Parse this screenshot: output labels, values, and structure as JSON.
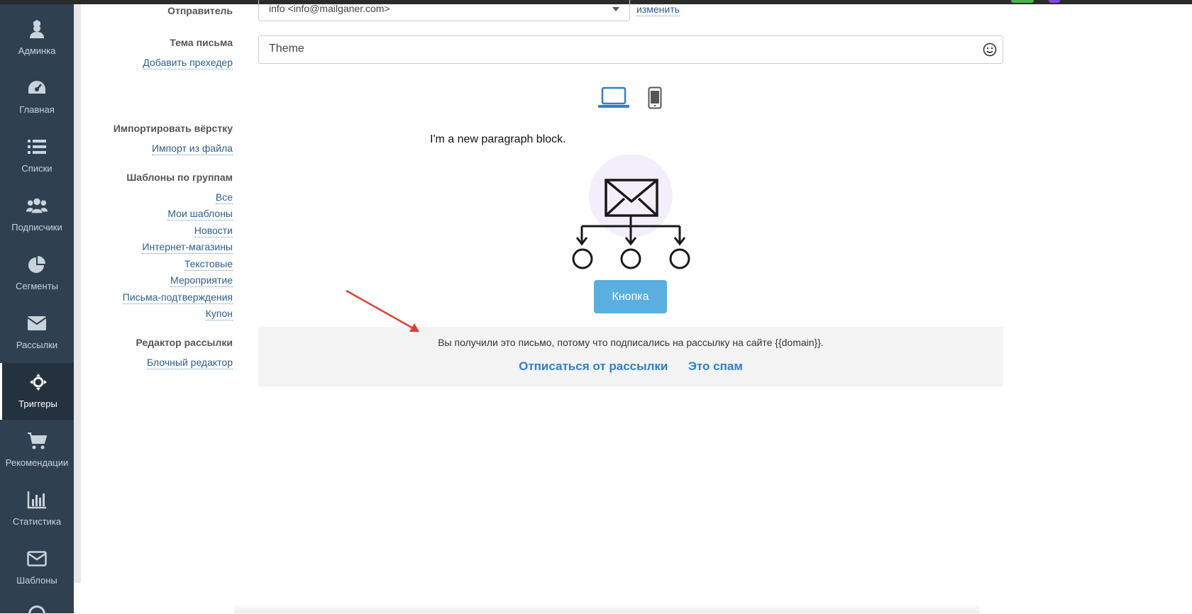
{
  "sidebar": {
    "items": [
      {
        "label": "Админка",
        "icon": "admin-user-icon"
      },
      {
        "label": "Главная",
        "icon": "dashboard-icon"
      },
      {
        "label": "Списки",
        "icon": "list-icon"
      },
      {
        "label": "Подписчики",
        "icon": "users-icon"
      },
      {
        "label": "Сегменты",
        "icon": "pie-chart-icon"
      },
      {
        "label": "Рассылки",
        "icon": "envelope-icon"
      },
      {
        "label": "Триггеры",
        "icon": "crosshair-icon",
        "active": true
      },
      {
        "label": "Рекомендации",
        "icon": "cart-icon"
      },
      {
        "label": "Статистика",
        "icon": "bar-chart-icon"
      },
      {
        "label": "Шаблоны",
        "icon": "envelope-outline-icon"
      }
    ]
  },
  "form": {
    "sender_label": "Отправитель",
    "sender_value": "info <info@mailganer.com>",
    "change_link": "изменить",
    "subject_label": "Тема письма",
    "add_preheader": "Добавить прехедер",
    "subject_value": "Theme"
  },
  "left_panel": {
    "import_title": "Импортировать вёрстку",
    "import_link": "Импорт из файла",
    "groups_title": "Шаблоны по группам",
    "groups": [
      "Все",
      "Мои шаблоны",
      "Новости",
      "Интернет-магазины",
      "Текстовые",
      "Мероприятие",
      "Письма-подтверждения",
      "Купон"
    ],
    "editor_title": "Редактор рассылки",
    "editor_link": "Блочный редактор"
  },
  "preview": {
    "paragraph": "I'm a new paragraph block.",
    "button_label": "Кнопка",
    "footer_text": "Вы получили это письмо, потому что подписались на рассылку на сайте {{domain}}.",
    "unsubscribe": "Отписаться от рассылки",
    "spam": "Это спам"
  },
  "colors": {
    "sidebar_bg": "#2f4050",
    "link": "#2c5d8f",
    "button": "#5aaee0",
    "accent_link": "#2f7fcf",
    "arrow": "#e0412f"
  }
}
